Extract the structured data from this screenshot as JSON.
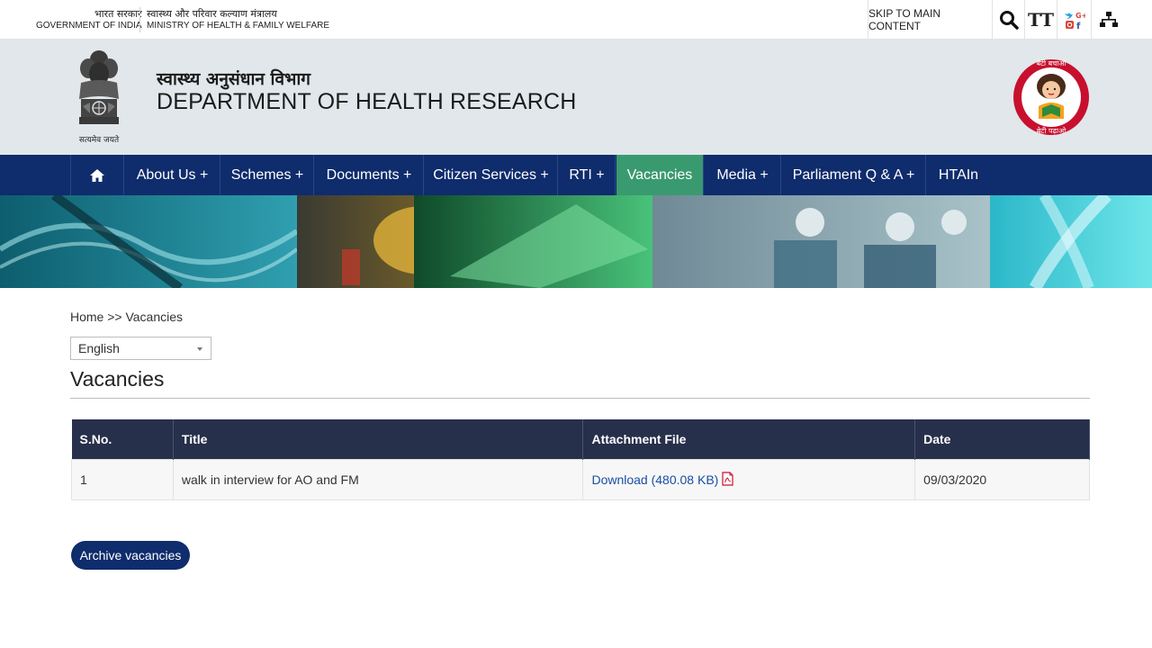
{
  "topbar": {
    "gov_hi": "भारत सरकार",
    "gov_en": "GOVERNMENT OF INDIA",
    "ministry_hi": "स्वास्थ्य और परिवार कल्याण मंत्रालय",
    "ministry_en": "MINISTRY OF HEALTH & FAMILY WELFARE",
    "skip_label": "SKIP TO MAIN CONTENT",
    "text_size_label": "TT",
    "icons": [
      "search-icon",
      "text-size-icon",
      "social-icon",
      "sitemap-icon"
    ]
  },
  "header": {
    "dept_hi": "स्वास्थ्य अनुसंधान विभाग",
    "dept_en": "DEPARTMENT OF HEALTH RESEARCH",
    "emblem_motto": "सत्यमेव जयते",
    "bbbp_top": "बेटी बचाओ",
    "bbbp_bottom": "बेटी पढ़ाओ"
  },
  "nav": {
    "items": [
      {
        "label": "About Us +"
      },
      {
        "label": "Schemes +"
      },
      {
        "label": "Documents +"
      },
      {
        "label": "Citizen Services +"
      },
      {
        "label": "RTI +"
      },
      {
        "label": "Vacancies"
      },
      {
        "label": "Media +"
      },
      {
        "label": "Parliament Q & A +"
      },
      {
        "label": "HTAIn"
      }
    ],
    "active": "Vacancies",
    "active_color": "#3a9a6f",
    "bar_color": "#0f2c6c"
  },
  "breadcrumb": "Home >> Vacancies",
  "language": {
    "selected": "English"
  },
  "page_title": "Vacancies",
  "table": {
    "headers": [
      "S.No.",
      "Title",
      "Attachment File",
      "Date"
    ],
    "rows": [
      {
        "sno": "1",
        "title": "walk in interview for AO and FM",
        "file": "Download (480.08 KB)",
        "date": "09/03/2020"
      }
    ]
  },
  "archive_label": "Archive vacancies"
}
